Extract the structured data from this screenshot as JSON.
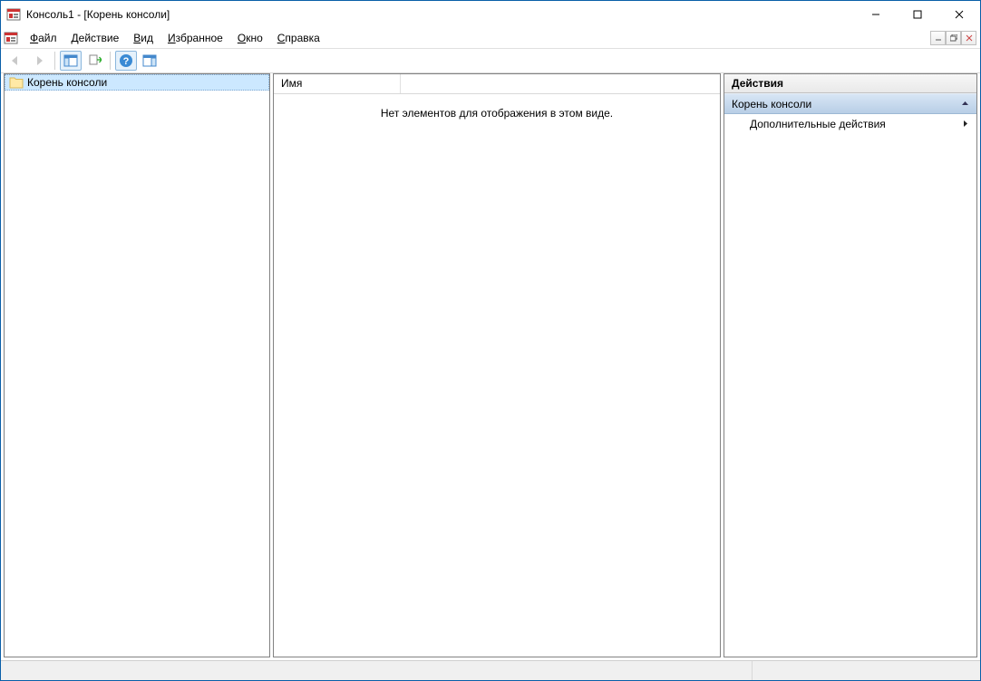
{
  "window": {
    "title": "Консоль1 - [Корень консоли]"
  },
  "menu": {
    "file": "Файл",
    "action": "Действие",
    "view": "Вид",
    "favorites": "Избранное",
    "window": "Окно",
    "help": "Справка"
  },
  "tree": {
    "root": "Корень консоли"
  },
  "list": {
    "column_name": "Имя",
    "empty_message": "Нет элементов для отображения в этом виде."
  },
  "actions": {
    "header": "Действия",
    "group_title": "Корень консоли",
    "more_actions": "Дополнительные действия"
  }
}
